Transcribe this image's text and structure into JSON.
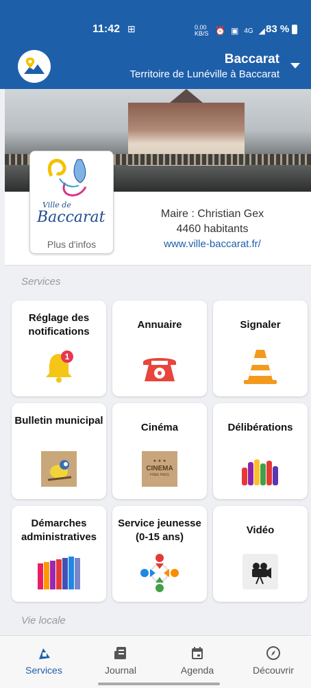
{
  "status_bar": {
    "time": "11:42",
    "data_speed": "0.00 KB/S",
    "network": "4G",
    "battery": "83 %"
  },
  "header": {
    "city": "Baccarat",
    "territory": "Territoire de Lunéville à Baccarat"
  },
  "city_info": {
    "logo_line1": "Ville de",
    "logo_line2": "Baccarat",
    "more_info": "Plus d'infos",
    "mayor": "Maire : Christian Gex",
    "population": "4460 habitants",
    "website": "www.ville-baccarat.fr/"
  },
  "sections": {
    "services": "Services",
    "local_life": "Vie locale"
  },
  "tiles": [
    {
      "label": "Réglage des notifications",
      "icon": "bell-icon",
      "badge": "1"
    },
    {
      "label": "Annuaire",
      "icon": "telephone-icon"
    },
    {
      "label": "Signaler",
      "icon": "traffic-cone-icon"
    },
    {
      "label": "Bulletin municipal",
      "icon": "bird-photo-icon"
    },
    {
      "label": "Cinéma",
      "icon": "cinema-ticket-icon",
      "ticket_stars": "★ ★ ★",
      "ticket_title": "CINEMA",
      "ticket_sub": "FREE PASS"
    },
    {
      "label": "Délibérations",
      "icon": "raised-hands-icon"
    },
    {
      "label": "Démarches administratives",
      "icon": "binders-icon"
    },
    {
      "label": "Service jeunesse (0-15 ans)",
      "icon": "people-circle-icon"
    },
    {
      "label": "Vidéo",
      "icon": "video-camera-icon"
    }
  ],
  "bottom_nav": [
    {
      "label": "Services",
      "icon": "services-icon",
      "active": true
    },
    {
      "label": "Journal",
      "icon": "journal-icon",
      "active": false
    },
    {
      "label": "Agenda",
      "icon": "calendar-icon",
      "active": false
    },
    {
      "label": "Découvrir",
      "icon": "compass-icon",
      "active": false
    }
  ],
  "colors": {
    "primary": "#1e5faa",
    "background": "#eef0f3",
    "badge": "#e53950"
  }
}
